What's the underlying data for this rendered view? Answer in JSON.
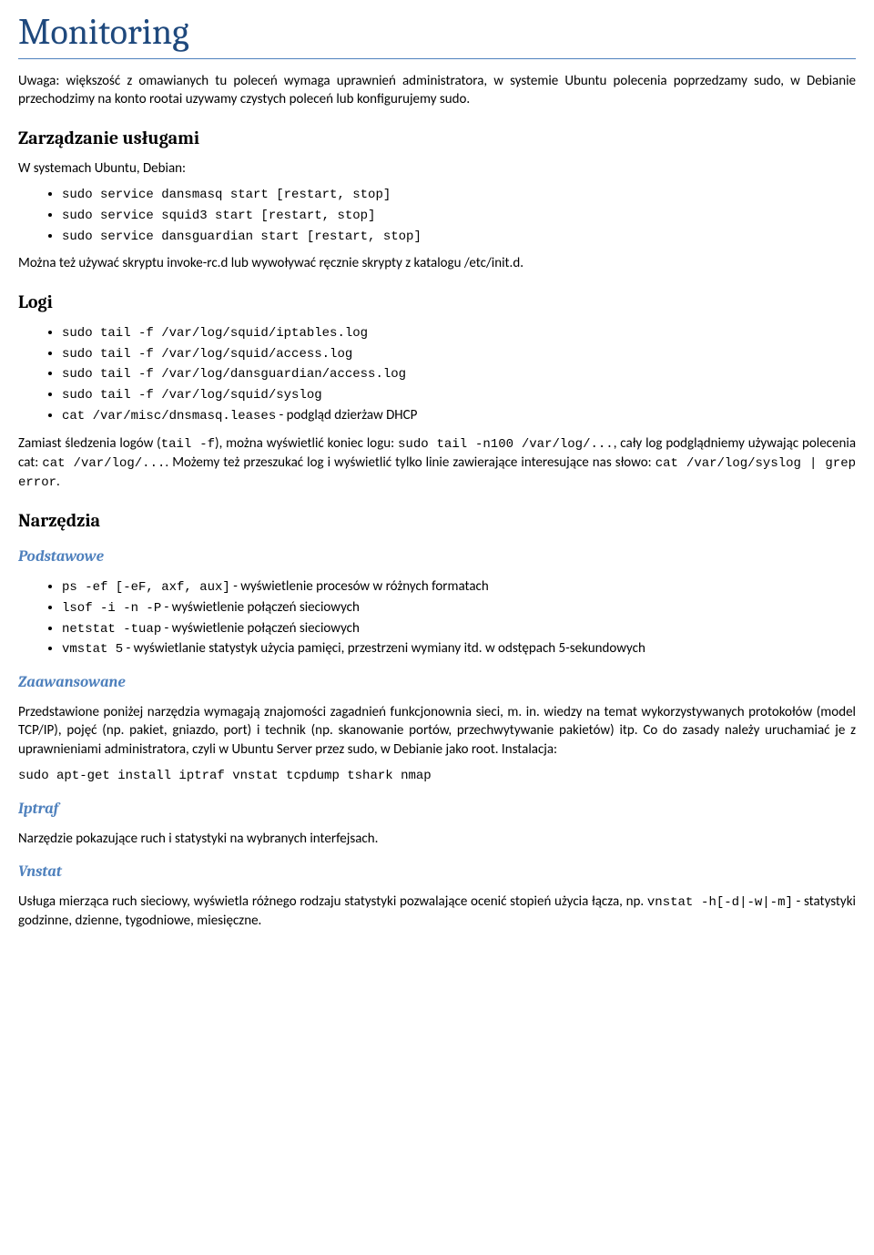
{
  "title": "Monitoring",
  "intro": "Uwaga: większość z omawianych tu poleceń wymaga uprawnień administratora, w systemie Ubuntu polecenia poprzedzamy sudo, w Debianie przechodzimy na konto rootai uzywamy czystych poleceń lub konfigurujemy sudo.",
  "s1": {
    "heading": "Zarządzanie usługami",
    "p1": "W systemach Ubuntu, Debian:",
    "items": [
      "sudo service dansmasq start [restart, stop]",
      "sudo service squid3 start [restart, stop]",
      "sudo service dansguardian start [restart, stop]"
    ],
    "p2": "Można też używać skryptu invoke-rc.d lub wywoływać ręcznie skrypty z katalogu /etc/init.d."
  },
  "s2": {
    "heading": "Logi",
    "items": [
      {
        "cmd": "sudo tail -f /var/log/squid/iptables.log",
        "desc": ""
      },
      {
        "cmd": "sudo tail -f /var/log/squid/access.log",
        "desc": ""
      },
      {
        "cmd": "sudo tail -f /var/log/dansguardian/access.log",
        "desc": ""
      },
      {
        "cmd": "sudo tail -f /var/log/squid/syslog",
        "desc": ""
      },
      {
        "cmd": "cat /var/misc/dnsmasq.leases",
        "desc": " - podgląd dzierżaw DHCP"
      }
    ],
    "para": {
      "t1": "Zamiast śledzenia logów (",
      "c1": "tail -f",
      "t2": "), można wyświetlić koniec logu: ",
      "c2": "sudo tail -n100 /var/log/...",
      "t3": ", cały log podglądniemy używając polecenia cat: ",
      "c3": "cat /var/log/...",
      "t4": ". Możemy też przeszukać log i wyświetlić tylko linie zawierające interesujące nas słowo: ",
      "c4": "cat /var/log/syslog | grep error",
      "t5": "."
    }
  },
  "s3": {
    "heading": "Narzędzia",
    "sub1": {
      "heading": "Podstawowe",
      "items": [
        {
          "cmd": "ps -ef [-eF, axf, aux]",
          "desc": " - wyświetlenie procesów w różnych formatach"
        },
        {
          "cmd": "lsof -i -n -P",
          "desc": " - wyświetlenie połączeń sieciowych"
        },
        {
          "cmd": "netstat -tuap",
          "desc": " - wyświetlenie połączeń sieciowych"
        },
        {
          "cmd": "vmstat 5",
          "desc": " - wyświetlanie statystyk użycia pamięci, przestrzeni wymiany itd. w odstępach 5-sekundowych"
        }
      ]
    },
    "sub2": {
      "heading": "Zaawansowane",
      "p1": "Przedstawione poniżej narzędzia wymagają znajomości zagadnień funkcjonownia sieci, m. in. wiedzy na temat wykorzystywanych protokołów (model TCP/IP), pojęć (np. pakiet, gniazdo, port) i technik (np. skanowanie portów, przechwytywanie pakietów) itp. Co do zasady należy uruchamiać je z uprawnieniami administratora, czyli w Ubuntu Server przez sudo, w Debianie jako root. Instalacja:",
      "cmd": "sudo apt-get install iptraf vnstat tcpdump tshark nmap"
    },
    "sub3": {
      "heading": "Iptraf",
      "p": "Narzędzie pokazujące ruch i statystyki na wybranych interfejsach."
    },
    "sub4": {
      "heading": "Vnstat",
      "p_t1": "Usługa mierząca ruch sieciowy, wyświetla różnego rodzaju statystyki pozwalające ocenić stopień użycia łącza, np. ",
      "p_c1": "vnstat -h[-d|-w|-m]",
      "p_t2": " - statystyki godzinne, dzienne, tygodniowe, miesięczne."
    }
  }
}
